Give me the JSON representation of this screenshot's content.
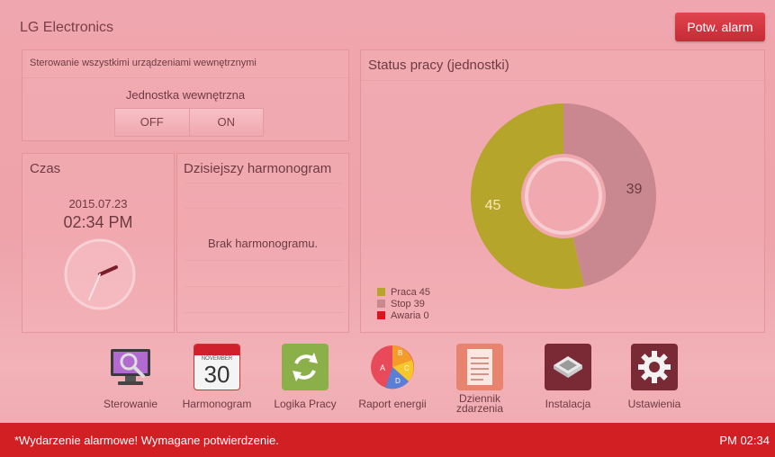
{
  "header": {
    "brand": "LG Electronics",
    "alarm_button": "Potw. alarm"
  },
  "control_panel": {
    "title": "Sterowanie wszystkimi urządzeniami wewnętrznymi",
    "unit_label": "Jednostka wewnętrzna",
    "off_label": "OFF",
    "on_label": "ON"
  },
  "time_panel": {
    "title": "Czas",
    "date": "2015.07.23",
    "time": "02:34 PM"
  },
  "schedule_panel": {
    "title": "Dzisiejszy harmonogram",
    "empty_text": "Brak harmonogramu."
  },
  "status_panel": {
    "title": "Status pracy (jednostki)"
  },
  "chart_data": {
    "type": "pie",
    "title": "Status pracy (jednostki)",
    "categories": [
      "Praca",
      "Stop",
      "Awaria"
    ],
    "values": [
      45,
      39,
      0
    ],
    "colors": [
      "#b5a52a",
      "#c98890",
      "#e0141e"
    ],
    "legend": [
      "Praca 45",
      "Stop 39",
      "Awaria 0"
    ],
    "data_labels": [
      "45",
      "39",
      ""
    ],
    "legend_position": "bottom-left"
  },
  "dock": {
    "items": [
      {
        "label": "Sterowanie",
        "icon": "monitor-magnifier-icon"
      },
      {
        "label": "Harmonogram",
        "icon": "calendar-icon",
        "calendar_month": "NOVEMBER",
        "calendar_day": "30"
      },
      {
        "label": "Logika Pracy",
        "icon": "refresh-cycle-icon"
      },
      {
        "label": "Raport energii",
        "icon": "pie-report-icon",
        "letters": [
          "A",
          "B",
          "C",
          "D"
        ]
      },
      {
        "label": "Dziennik zdarzenia",
        "icon": "clipboard-log-icon"
      },
      {
        "label": "Instalacja",
        "icon": "ceiling-cassette-icon"
      },
      {
        "label": "Ustawienia",
        "icon": "gear-icon"
      }
    ]
  },
  "footer": {
    "message": "*Wydarzenie alarmowe! Wymagane potwierdzenie.",
    "time": "PM 02:34"
  }
}
